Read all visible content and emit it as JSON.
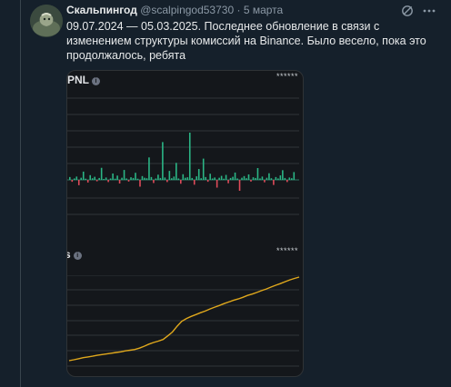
{
  "post": {
    "author": "Скальпингод",
    "handle": "@scalpingod53730",
    "separator": "·",
    "date": "5 марта",
    "text": "09.07.2024 — 05.03.2025. Последнее обновление в связи с изменением структуры комиссий на Binance. Было весело, пока это продолжалось, ребята"
  },
  "icons": [
    "grok-icon",
    "more-icon"
  ],
  "colors": {
    "background": "#15202b",
    "positive_bar": "#2bb686",
    "negative_bar": "#e04b5a",
    "cumulative_line": "#e0a81c",
    "text_secondary": "#8b98a5"
  },
  "charts": {
    "daily": {
      "title": "PNL",
      "masked_value": "******"
    },
    "cumulative": {
      "title": "s",
      "masked_value": "******"
    }
  },
  "chart_data": [
    {
      "type": "bar",
      "title": "PNL",
      "values": [
        1.2,
        -0.8,
        0.6,
        1.4,
        -2.2,
        0.9,
        3.5,
        0.5,
        -1.1,
        2.0,
        0.7,
        1.3,
        -0.6,
        0.8,
        5.1,
        0.4,
        1.0,
        -0.9,
        0.6,
        2.7,
        0.5,
        1.8,
        -1.5,
        0.9,
        4.2,
        0.6,
        -0.7,
        1.1,
        0.8,
        3.0,
        0.5,
        -2.8,
        1.6,
        0.9,
        0.7,
        9.5,
        1.2,
        -1.3,
        0.6,
        2.2,
        0.8,
        16.0,
        1.0,
        -0.9,
        3.8,
        0.7,
        1.4,
        7.2,
        0.6,
        -1.6,
        2.4,
        0.9,
        1.1,
        20.0,
        0.8,
        -2.0,
        1.5,
        4.6,
        0.7,
        9.0,
        1.2,
        -0.8,
        2.6,
        0.6,
        1.0,
        -3.2,
        0.9,
        1.7,
        0.5,
        2.1,
        -1.4,
        0.8,
        1.3,
        3.1,
        0.6,
        -4.5,
        0.9,
        1.6,
        0.7,
        2.3,
        -0.7,
        1.1,
        0.8,
        5.0,
        0.6,
        1.4,
        -1.0,
        0.9,
        2.8,
        0.7,
        -2.1,
        1.2,
        0.6,
        1.9,
        4.1,
        0.8,
        -0.9,
        1.0,
        0.7,
        3.3
      ],
      "grid": true
    },
    {
      "type": "line",
      "title": "s",
      "series": [
        {
          "values": [
            0.0,
            0.4,
            0.8,
            1.3,
            1.6,
            1.9,
            2.3,
            2.6,
            2.9,
            3.2,
            3.5,
            3.8,
            4.2,
            4.5,
            4.8,
            5.4,
            6.2,
            7.1,
            7.8,
            8.4,
            9.1,
            10.6,
            12.3,
            14.8,
            16.9,
            18.1,
            19.0,
            19.8,
            20.6,
            21.3,
            22.2,
            23.0,
            23.7,
            24.5,
            25.2,
            25.9,
            26.5,
            27.2,
            28.0,
            28.6,
            29.3,
            30.1,
            30.8,
            31.6,
            32.4,
            33.1,
            33.9,
            34.7,
            35.3,
            35.9
          ]
        }
      ],
      "grid": true
    }
  ]
}
